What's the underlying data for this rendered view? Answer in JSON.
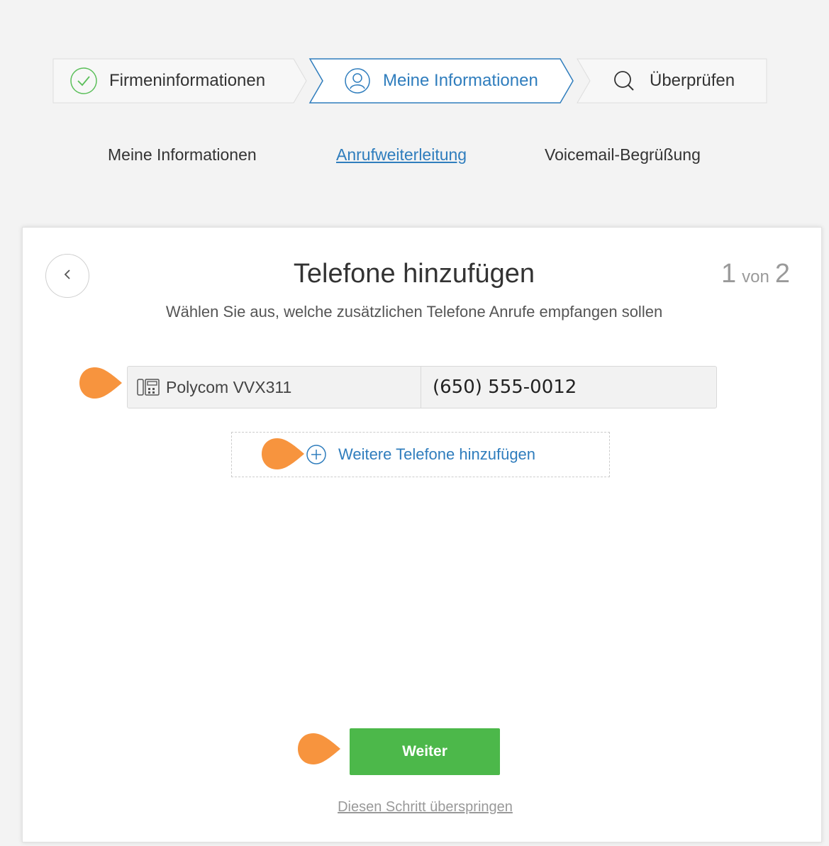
{
  "stepper": {
    "steps": [
      {
        "label": "Firmeninformationen",
        "icon": "check-circle-icon",
        "state": "completed"
      },
      {
        "label": "Meine Informationen",
        "icon": "user-circle-icon",
        "state": "active"
      },
      {
        "label": "Überprüfen",
        "icon": "search-icon",
        "state": "pending"
      }
    ]
  },
  "subnav": {
    "items": [
      {
        "label": "Meine Informationen"
      },
      {
        "label": "Anrufweiterleitung",
        "active": true
      },
      {
        "label": "Voicemail-Begrüßung"
      }
    ]
  },
  "card": {
    "title": "Telefone hinzufügen",
    "page_current": "1",
    "page_sep": "von",
    "page_total": "2",
    "subtitle": "Wählen Sie aus, welche zusätzlichen Telefone Anrufe empfangen sollen",
    "phone": {
      "device_name": "Polycom VVX311",
      "device_icon": "desk-phone-icon",
      "number": "(650) 555-0012"
    },
    "add_phones_label": "Weitere Telefone hinzufügen",
    "next_label": "Weiter",
    "skip_label": "Diesen Schritt überspringen"
  },
  "colors": {
    "accent_blue": "#2f7dbd",
    "success_green": "#4cb84a",
    "check_green": "#5bbf5a",
    "marker_orange": "#f7943e"
  }
}
